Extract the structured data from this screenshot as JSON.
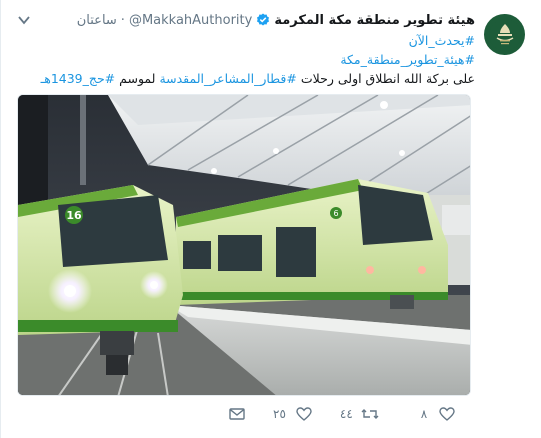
{
  "tweet": {
    "display_name": "هيئة تطوير منطقة مكة المكرمة",
    "handle": "@MakkahAuthority",
    "separator": "·",
    "time": "ساعتان",
    "line1_hashtag": "#يحدث_الآن",
    "line2_hashtag": "#هيئة_تطوير_منطقة_مكة",
    "line3_text": "على بركة الله انطلاق اولى رحلات",
    "line3_hashtag1": "#قطار_المشاعر_المقدسة",
    "line3_text2": "لموسم",
    "line3_hashtag2": "#حج_1439هـ",
    "verified_color": "#1da1f2",
    "hashtag_color": "#1b95e0"
  },
  "media": {
    "train_left_number": "16",
    "train_right_number": "6"
  },
  "actions": {
    "likes_count": "٨",
    "retweets_count": "٤٤",
    "replies_count": "٢٥"
  },
  "icons": {
    "avatar": "authority-logo-icon",
    "verified": "verified-badge-icon",
    "caret": "chevron-down-icon",
    "like": "heart-icon",
    "retweet": "retweet-icon",
    "reply": "reply-icon",
    "dm": "envelope-icon"
  }
}
